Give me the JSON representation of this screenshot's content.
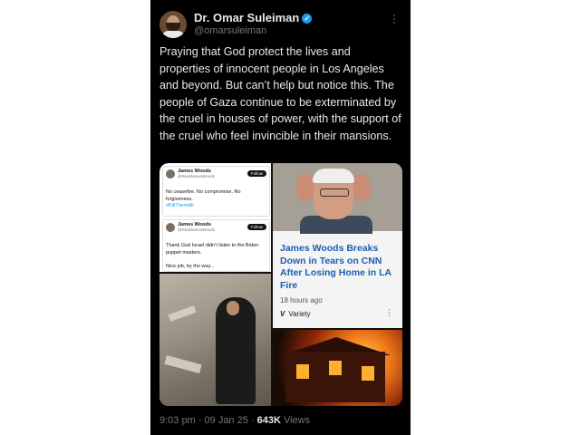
{
  "author": {
    "name": "Dr. Omar Suleiman",
    "handle": "@omarsuleiman",
    "verified_icon": "verified-badge-icon"
  },
  "tweet": {
    "text": "Praying that God protect the lives and properties of innocent people in Los Angeles and beyond. But can’t help but notice this. The people of Gaza continue to be exterminated by the cruel in houses of power, with the support of the cruel who feel invincible in their mansions."
  },
  "media": {
    "screenshot1": {
      "name": "James Woods",
      "handle": "@RealJamesWoods",
      "follow": "Follow",
      "text": "No ceasefire. No compromise. No forgiveness.",
      "hashtag": "#KillThemAll"
    },
    "screenshot2": {
      "name": "James Woods",
      "handle": "@RealJamesWoods",
      "follow": "Follow",
      "text": "Thank God Israel didn’t listen to the Biden puppet masters.",
      "nice": "Nice job, by the way..."
    },
    "news": {
      "title": "James Woods Breaks Down in Tears on CNN After Losing Home in LA Fire",
      "time": "18 hours ago",
      "source": "Variety",
      "source_logo": "V"
    }
  },
  "meta": {
    "time": "9:03 pm · 09 Jan 25 · ",
    "views_count": "643K",
    "views_label": " Views"
  }
}
